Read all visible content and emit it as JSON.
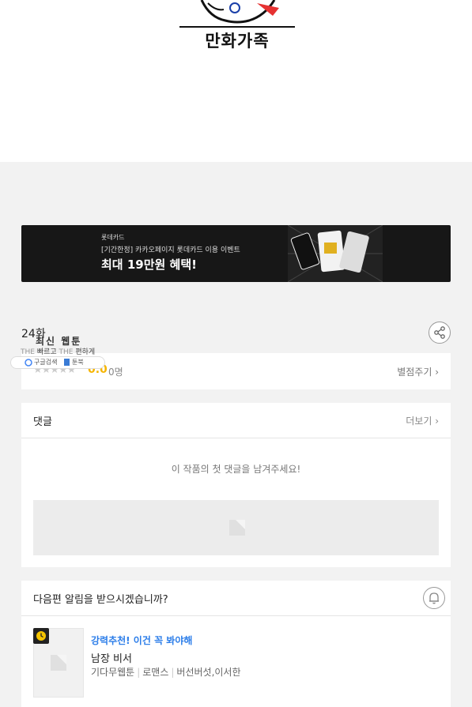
{
  "header": {
    "logo_text": "만화가족"
  },
  "banner": {
    "brand": "롯데카드",
    "subtitle": "[기간한정] 카카오페이지 롯데카드 이용 이벤트",
    "headline": "최대 19만원 혜택!"
  },
  "episode": {
    "title": "24화"
  },
  "overlay_badge": {
    "title": "최신 웹툰",
    "tagline_the1": "THE",
    "tagline_fast": "빠르고",
    "tagline_the2": "THE",
    "tagline_easy": "편하게",
    "search": "구글검색",
    "site": "툰북"
  },
  "rating": {
    "stars": "★★★★★",
    "score": "0.0",
    "count": "0명",
    "action": "별점주기 ›"
  },
  "comments": {
    "title": "댓글",
    "more": "더보기 ›",
    "empty_message": "이 작품의 첫 댓글을 남겨주세요!"
  },
  "notify": {
    "question": "다음편 알림을 받으시겠습니까?"
  },
  "recommendation": {
    "tag": "강력추천! 이건 꼭 봐야해",
    "title": "남장 비서",
    "category": "기다무웹툰",
    "genre": "로맨스",
    "authors": "버선버섯,이서한"
  },
  "colors": {
    "accent_blue": "#2b7de9",
    "star_yellow": "#f5b400",
    "banner_bg": "#171717"
  },
  "icons": {
    "share": "share-icon",
    "bell": "bell-icon",
    "clock": "clock-icon"
  }
}
